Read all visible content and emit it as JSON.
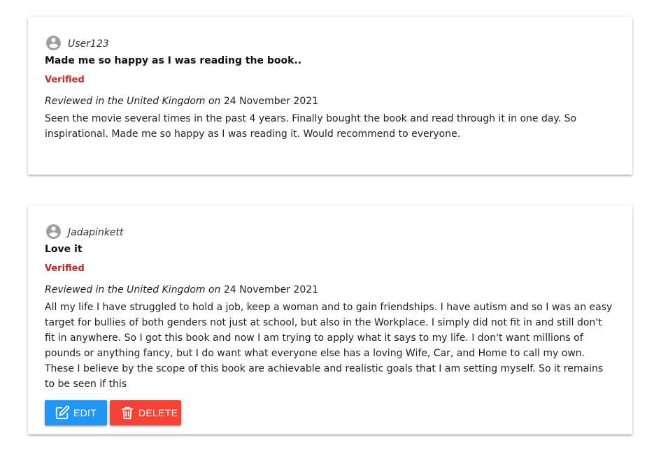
{
  "reviews": [
    {
      "username": "User123",
      "title": "Made me so happy as I was reading the book..",
      "verified": "Verified",
      "reviewed_prefix": "Reviewed in the United Kingdom on",
      "date": "24 November 2021",
      "body": "Seen the movie several times in the past 4 years. Finally bought the book and read through it in one day. So inspirational. Made me so happy as I was reading it. Would recommend to everyone."
    },
    {
      "username": "Jadapinkett",
      "title": "Love it",
      "verified": "Verified",
      "reviewed_prefix": "Reviewed in the United Kingdom on",
      "date": "24 November 2021",
      "body": "All my life I have struggled to hold a job, keep a woman and to gain friendships. I have autism and so I was an easy target for bullies of both genders not just at school, but also in the Workplace. I simply did not fit in and still don't fit in anywhere. So I got this book and now I am trying to apply what it says to my life. I don't want millions of pounds or anything fancy, but I do want what everyone else has a loving Wife, Car, and Home to call my own. These I believe by the scope of this book are achievable and realistic goals that I am setting myself. So it remains to be seen if this",
      "actions": {
        "edit_label": "Edit",
        "delete_label": "Delete"
      }
    }
  ],
  "icons": {
    "avatar": "account-circle-icon",
    "edit": "edit-square-icon",
    "delete": "trash-icon"
  },
  "colors": {
    "verified": "#c62828",
    "edit_button": "#2196f3",
    "delete_button": "#f44336"
  }
}
